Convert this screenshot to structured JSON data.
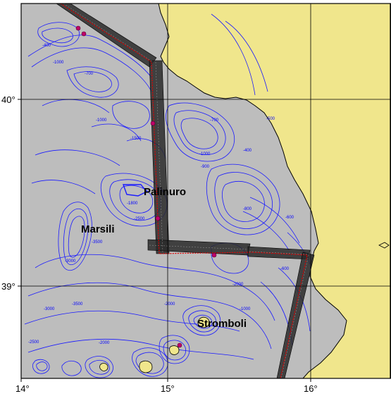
{
  "map": {
    "lon_ticks": [
      "14°",
      "15°",
      "16°"
    ],
    "lat_ticks": [
      "40°",
      "39°"
    ],
    "places": [
      {
        "name": "Palinuro"
      },
      {
        "name": "Marsili"
      },
      {
        "name": "Stromboli"
      }
    ],
    "contour_labels": [
      "-100",
      "-400",
      "-500",
      "-700",
      "-1000",
      "-1500",
      "-2000",
      "-2500",
      "-3000",
      "-3500",
      "-800",
      "-600",
      "-300",
      "-200",
      "-900",
      "-1200",
      "-1800"
    ],
    "colors": {
      "land": "#f0e68c",
      "sea": "#bdbdbd",
      "contour": "#1a1aff",
      "track": "#e00000",
      "swath": "#2a2a2a",
      "grid": "#000000",
      "station": "#c0006a"
    }
  }
}
